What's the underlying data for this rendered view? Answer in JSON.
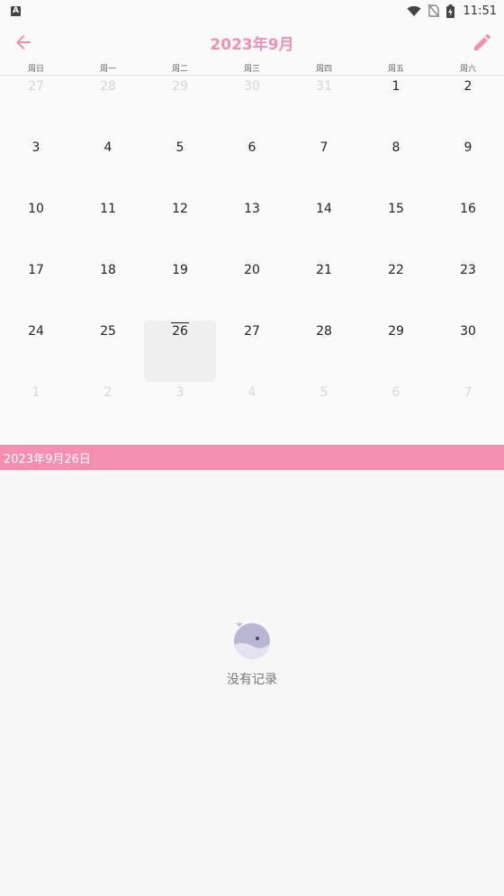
{
  "status_bar": {
    "left_icon": "A",
    "time": "11:51",
    "icons": [
      "wifi-icon",
      "no-sim-icon",
      "battery-charging-icon"
    ]
  },
  "header": {
    "title": "2023年9月",
    "back_icon": "arrow-left-icon",
    "edit_icon": "pencil-icon",
    "accent_color": "#f48fb1"
  },
  "weekdays": [
    "周日",
    "周一",
    "周二",
    "周三",
    "周四",
    "周五",
    "周六"
  ],
  "days": [
    {
      "label": "27",
      "muted": true
    },
    {
      "label": "28",
      "muted": true
    },
    {
      "label": "29",
      "muted": true
    },
    {
      "label": "30",
      "muted": true
    },
    {
      "label": "31",
      "muted": true
    },
    {
      "label": "1"
    },
    {
      "label": "2"
    },
    {
      "label": "3"
    },
    {
      "label": "4"
    },
    {
      "label": "5"
    },
    {
      "label": "6"
    },
    {
      "label": "7"
    },
    {
      "label": "8"
    },
    {
      "label": "9"
    },
    {
      "label": "10"
    },
    {
      "label": "11"
    },
    {
      "label": "12"
    },
    {
      "label": "13"
    },
    {
      "label": "14"
    },
    {
      "label": "15"
    },
    {
      "label": "16"
    },
    {
      "label": "17"
    },
    {
      "label": "18"
    },
    {
      "label": "19"
    },
    {
      "label": "20"
    },
    {
      "label": "21"
    },
    {
      "label": "22"
    },
    {
      "label": "23"
    },
    {
      "label": "24"
    },
    {
      "label": "25"
    },
    {
      "label": "26",
      "selected": true,
      "today": true
    },
    {
      "label": "27"
    },
    {
      "label": "28"
    },
    {
      "label": "29"
    },
    {
      "label": "30"
    },
    {
      "label": "1",
      "muted": true
    },
    {
      "label": "2",
      "muted": true
    },
    {
      "label": "3",
      "muted": true
    },
    {
      "label": "4",
      "muted": true
    },
    {
      "label": "5",
      "muted": true
    },
    {
      "label": "6",
      "muted": true
    },
    {
      "label": "7",
      "muted": true
    }
  ],
  "selected_date_banner": "2023年9月26日",
  "empty_state": {
    "icon": "whale-icon",
    "text": "没有记录"
  }
}
